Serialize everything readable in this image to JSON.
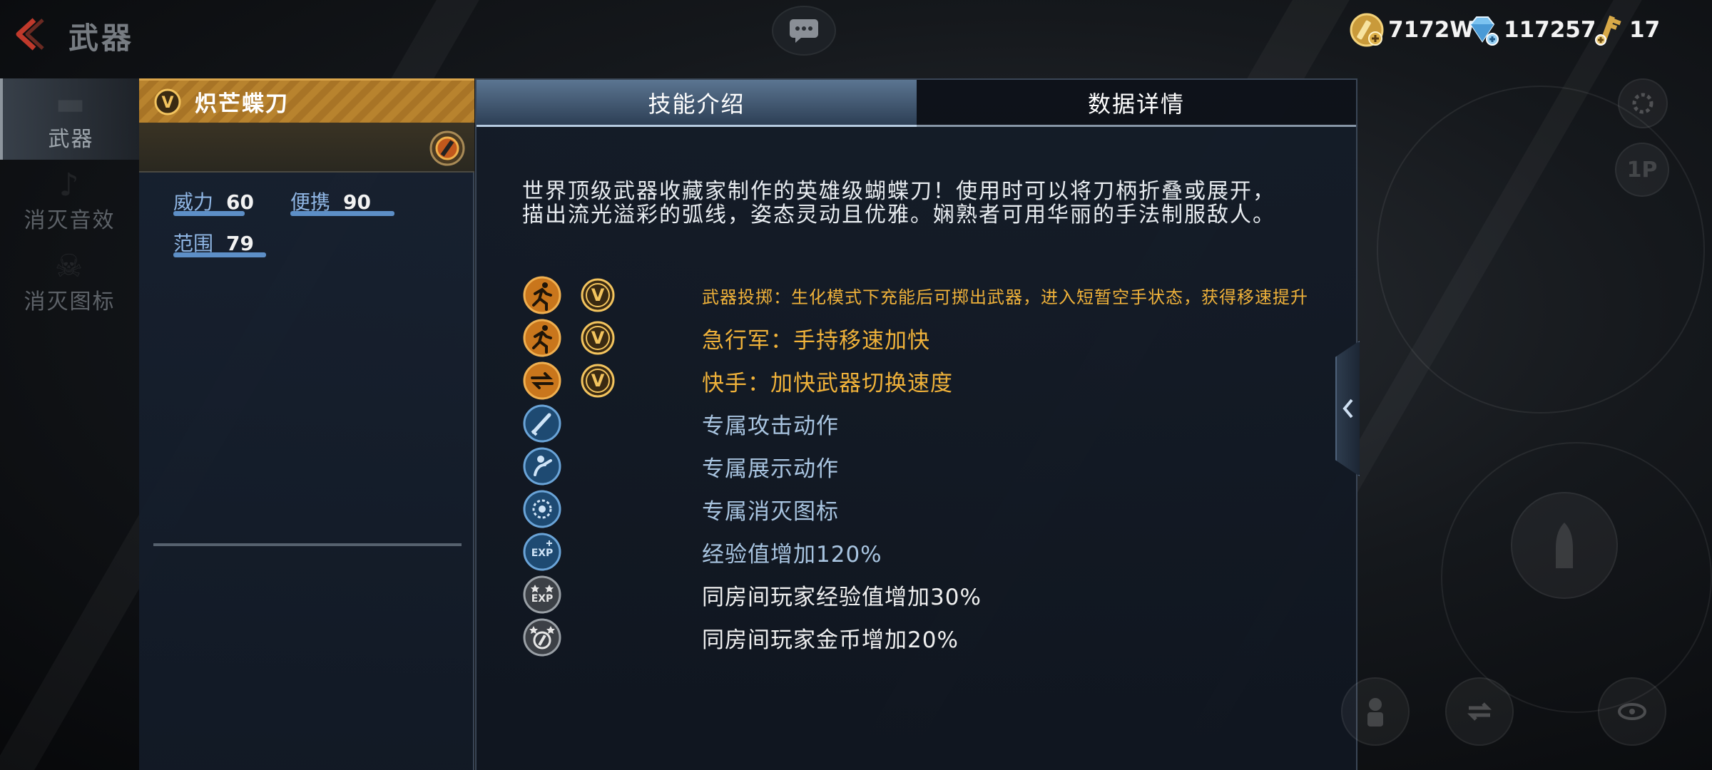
{
  "header": {
    "title": "武器",
    "chat_icon": "chat-bubble-icon"
  },
  "currencies": [
    {
      "icon": "gold-coin-icon",
      "value": "7172W"
    },
    {
      "icon": "diamond-icon",
      "value": "117257"
    },
    {
      "icon": "key-icon",
      "value": "17"
    }
  ],
  "sidebar": {
    "items": [
      {
        "label": "武器",
        "active": true
      },
      {
        "label": "消灭音效",
        "active": false
      },
      {
        "label": "消灭图标",
        "active": false
      }
    ]
  },
  "weapon": {
    "name": "炽芒蝶刀",
    "rank_badge": "V",
    "stats": [
      {
        "label": "威力",
        "value": "60"
      },
      {
        "label": "便携",
        "value": "90"
      },
      {
        "label": "范围",
        "value": "79"
      }
    ]
  },
  "tabs": [
    {
      "label": "技能介绍",
      "active": true
    },
    {
      "label": "数据详情",
      "active": false
    }
  ],
  "description": "世界顶级武器收藏家制作的英雄级蝴蝶刀！使用时可以将刀柄折叠或展开，描出流光溢彩的弧线，姿态灵动且优雅。娴熟者可用华丽的手法制服敌人。",
  "skills": [
    {
      "icon": "running-man-icon",
      "badge": "V",
      "text": "武器投掷：生化模式下充能后可掷出武器，进入短暂空手状态，获得移速提升",
      "color": "gold"
    },
    {
      "icon": "running-man-icon",
      "badge": "V",
      "text": "急行军：手持移速加快",
      "color": "gold"
    },
    {
      "icon": "weapon-swap-icon",
      "badge": "V",
      "text": "快手：加快武器切换速度",
      "color": "gold"
    },
    {
      "icon": "knife-attack-icon",
      "badge": "",
      "text": "专属攻击动作",
      "color": "blue"
    },
    {
      "icon": "inspect-action-icon",
      "badge": "",
      "text": "专属展示动作",
      "color": "blue"
    },
    {
      "icon": "kill-mark-icon",
      "badge": "",
      "text": "专属消灭图标",
      "color": "blue"
    },
    {
      "icon": "exp-icon",
      "badge": "",
      "text": "经验值增加120%",
      "color": "blue"
    },
    {
      "icon": "room-exp-icon",
      "badge": "",
      "text": "同房间玩家经验值增加30%",
      "color": "white"
    },
    {
      "icon": "room-coin-icon",
      "badge": "",
      "text": "同房间玩家金币增加20%",
      "color": "white"
    }
  ],
  "right_controls": {
    "perspective_label": "1P"
  },
  "colors": {
    "gold_accent": "#f0b23a",
    "blue_text": "#a8c4e0",
    "stat_bar": "#5d8fc7"
  }
}
